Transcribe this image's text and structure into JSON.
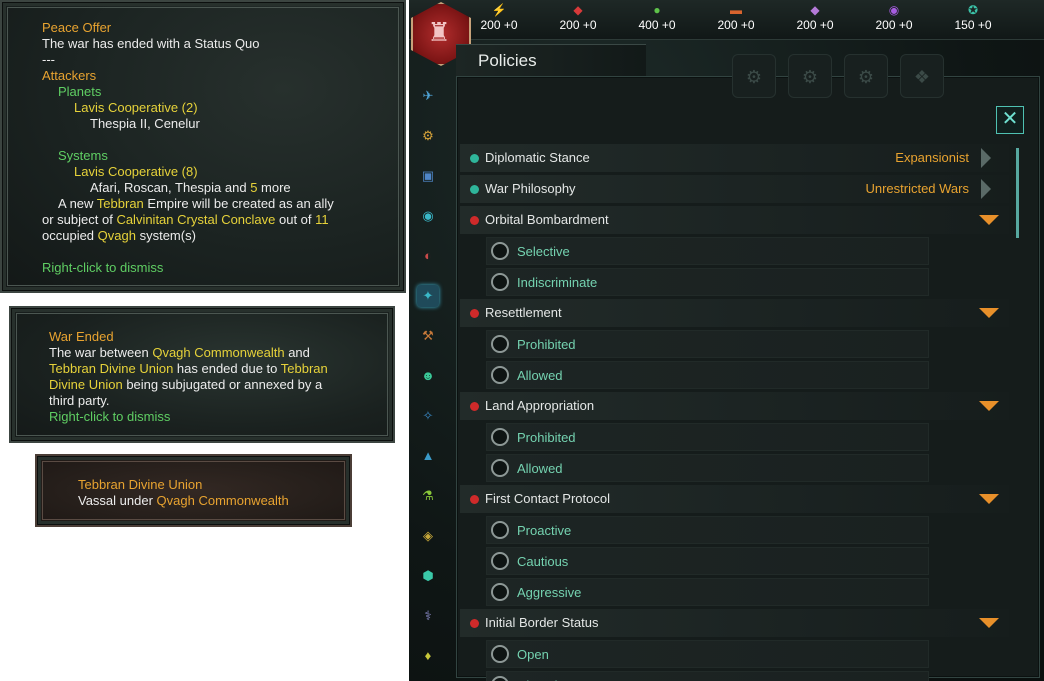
{
  "tooltip_peace": {
    "title": "Peace Offer",
    "line1": "The war has ended with a Status Quo",
    "separator": "---",
    "attackers": "Attackers",
    "planets": "Planets",
    "planets_owner": "Lavis Cooperative (2)",
    "planets_list": "Thespia II, Cenelur",
    "systems": "Systems",
    "systems_owner": "Lavis Cooperative (8)",
    "systems_list_a": "Afari, Roscan, Thespia and ",
    "systems_more_count": "5",
    "systems_list_b": " more",
    "new_empire_a": "A new ",
    "new_empire_name": "Tebbran",
    "new_empire_b": " Empire will be created as an ally",
    "subject_a": "or subject of ",
    "subject_name": "Calvinitan Crystal Conclave",
    "subject_b": " out of ",
    "subject_count": "11",
    "occupied_a": "occupied ",
    "occupied_name": "Qvagh",
    "occupied_b": " system(s)",
    "dismiss": "Right-click to dismiss"
  },
  "tooltip_war": {
    "title": "War Ended",
    "l1a": "The war between ",
    "l1b": "Qvagh Commonwealth",
    "l1c": " and",
    "l2a": "Tebbran Divine Union",
    "l2b": " has ended due to ",
    "l2c": "Tebbran",
    "l3a": "Divine Union",
    "l3b": " being subjugated or annexed by a",
    "l4": "third party.",
    "dismiss": "Right-click to dismiss"
  },
  "tooltip_vassal": {
    "title": "Tebbran Divine Union",
    "status_a": "Vassal under ",
    "status_b": "Qvagh Commonwealth"
  },
  "resources": [
    {
      "icon": "energy-icon",
      "glyph": "⚡",
      "color": "#e7c33a",
      "value": "200 +0"
    },
    {
      "icon": "minerals-icon",
      "glyph": "◆",
      "color": "#d83a3a",
      "value": "200 +0"
    },
    {
      "icon": "food-icon",
      "glyph": "●",
      "color": "#5ec24a",
      "value": "400 +0"
    },
    {
      "icon": "consumer-goods-icon",
      "glyph": "▬",
      "color": "#d8642e",
      "value": "200 +0"
    },
    {
      "icon": "alloys-icon",
      "glyph": "◆",
      "color": "#b47ad8",
      "value": "200 +0"
    },
    {
      "icon": "influence-icon",
      "glyph": "◉",
      "color": "#a65ce0",
      "value": "200 +0"
    },
    {
      "icon": "unity-icon",
      "glyph": "✪",
      "color": "#3bc2a8",
      "value": "150 +0"
    }
  ],
  "window": {
    "title": "Policies",
    "close": "✕"
  },
  "policies": [
    {
      "label": "Diplomatic Stance",
      "status": "set",
      "dot": "#2fb59a",
      "value": "Expansionist",
      "options": []
    },
    {
      "label": "War Philosophy",
      "status": "set",
      "dot": "#2fb59a",
      "value": "Unrestricted Wars",
      "options": []
    },
    {
      "label": "Orbital Bombardment",
      "status": "open",
      "dot": "#cf2a2a",
      "value": "",
      "options": [
        "Selective",
        "Indiscriminate"
      ]
    },
    {
      "label": "Resettlement",
      "status": "open",
      "dot": "#cf2a2a",
      "value": "",
      "options": [
        "Prohibited",
        "Allowed"
      ]
    },
    {
      "label": "Land Appropriation",
      "status": "open",
      "dot": "#cf2a2a",
      "value": "",
      "options": [
        "Prohibited",
        "Allowed"
      ]
    },
    {
      "label": "First Contact Protocol",
      "status": "open",
      "dot": "#cf2a2a",
      "value": "",
      "options": [
        "Proactive",
        "Cautious",
        "Aggressive"
      ]
    },
    {
      "label": "Initial Border Status",
      "status": "open",
      "dot": "#cf2a2a",
      "value": "",
      "options": [
        "Open",
        "Closed"
      ]
    }
  ]
}
